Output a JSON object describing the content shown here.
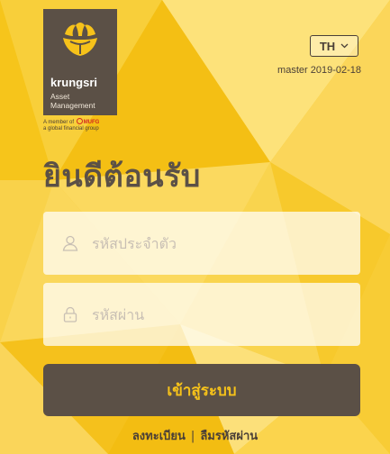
{
  "brand": {
    "name": "krungsri",
    "subtitle_line1": "Asset",
    "subtitle_line2": "Management",
    "member_prefix": "A member of",
    "member_brand": "MUFG",
    "member_suffix": "a global financial group"
  },
  "language": {
    "selected": "TH",
    "icon": "chevron-down-icon"
  },
  "version": "master 2019-02-18",
  "welcome_title": "ยินดีต้อนรับ",
  "form": {
    "username": {
      "placeholder": "รหัสประจำตัว",
      "value": "",
      "icon": "user-icon"
    },
    "password": {
      "placeholder": "รหัสผ่าน",
      "value": "",
      "icon": "lock-icon"
    },
    "submit_label": "เข้าสู่ระบบ"
  },
  "links": {
    "register": "ลงทะเบียน",
    "separator": "|",
    "forgot_password": "ลืมรหัสผ่าน"
  },
  "colors": {
    "background_yellow": "#f6c51b",
    "brand_brown": "#5b5046",
    "button_text": "#f6c21a",
    "mufg_red": "#d42a1f"
  }
}
